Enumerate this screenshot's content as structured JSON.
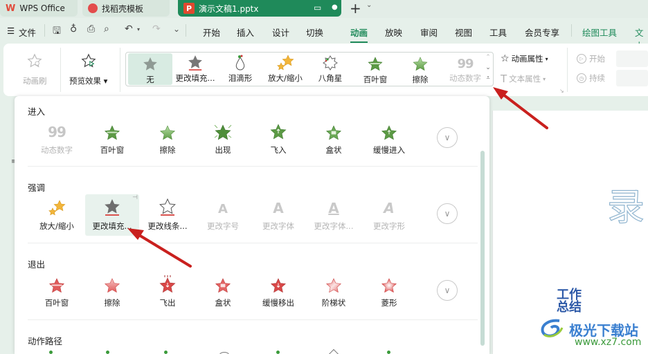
{
  "tabs": [
    {
      "label": "WPS Office",
      "icon": "wps-logo-icon"
    },
    {
      "label": "找稻壳模板",
      "icon": "docer-logo-icon"
    },
    {
      "label": "演示文稿1.pptx",
      "icon": "pptx-logo-icon",
      "active": true
    }
  ],
  "tabbar": {
    "new_tab": "+",
    "dropdown": "⌄"
  },
  "menubar": {
    "menu_label": "文件",
    "tabs": [
      "开始",
      "插入",
      "设计",
      "切换",
      "动画",
      "放映",
      "审阅",
      "视图",
      "工具",
      "会员专享",
      "绘图工具",
      "文本"
    ],
    "active_tab": "动画"
  },
  "ribbon": {
    "anim_brush": "动画刷",
    "preview": "预览效果",
    "gallery": [
      {
        "label": "无",
        "icon": "star-gray-icon",
        "selected": true
      },
      {
        "label": "更改填充...",
        "icon": "star-fill-change-icon"
      },
      {
        "label": "泪滴形",
        "icon": "teardrop-path-icon"
      },
      {
        "label": "放大/缩小",
        "icon": "stars-grow-icon"
      },
      {
        "label": "八角星",
        "icon": "eight-point-star-icon"
      },
      {
        "label": "百叶窗",
        "icon": "star-blinds-icon"
      },
      {
        "label": "擦除",
        "icon": "star-wipe-icon"
      },
      {
        "label": "动态数字",
        "icon": "digits-icon",
        "disabled": true
      }
    ],
    "anim_props": "动画属性",
    "text_props": "文本属性",
    "start": "开始",
    "duration": "持续"
  },
  "panel": {
    "sections": [
      {
        "title": "进入",
        "color": "green",
        "items": [
          {
            "label": "动态数字",
            "disabled": true
          },
          {
            "label": "百叶窗"
          },
          {
            "label": "擦除"
          },
          {
            "label": "出现"
          },
          {
            "label": "飞入"
          },
          {
            "label": "盒状"
          },
          {
            "label": "缓慢进入"
          }
        ]
      },
      {
        "title": "强调",
        "color": "mixed",
        "items": [
          {
            "label": "放大/缩小"
          },
          {
            "label": "更改填充...",
            "hovered": true
          },
          {
            "label": "更改线条..."
          },
          {
            "label": "更改字号",
            "disabled": true
          },
          {
            "label": "更改字体",
            "disabled": true
          },
          {
            "label": "更改字体...",
            "disabled": true
          },
          {
            "label": "更改字形",
            "disabled": true
          }
        ]
      },
      {
        "title": "退出",
        "color": "red",
        "items": [
          {
            "label": "百叶窗"
          },
          {
            "label": "擦除"
          },
          {
            "label": "飞出"
          },
          {
            "label": "盒状"
          },
          {
            "label": "缓慢移出"
          },
          {
            "label": "阶梯状"
          },
          {
            "label": "菱形"
          }
        ]
      },
      {
        "title": "动作路径",
        "items": []
      }
    ]
  },
  "slide": {
    "big_char": "录",
    "logo_text1": "工作",
    "logo_text2": "总结",
    "watermark_cn": "极光下载站",
    "watermark_url": "www.xz7.com"
  },
  "colors": {
    "accent": "#1f8a5a",
    "annotation_arrow": "#c9201e"
  }
}
